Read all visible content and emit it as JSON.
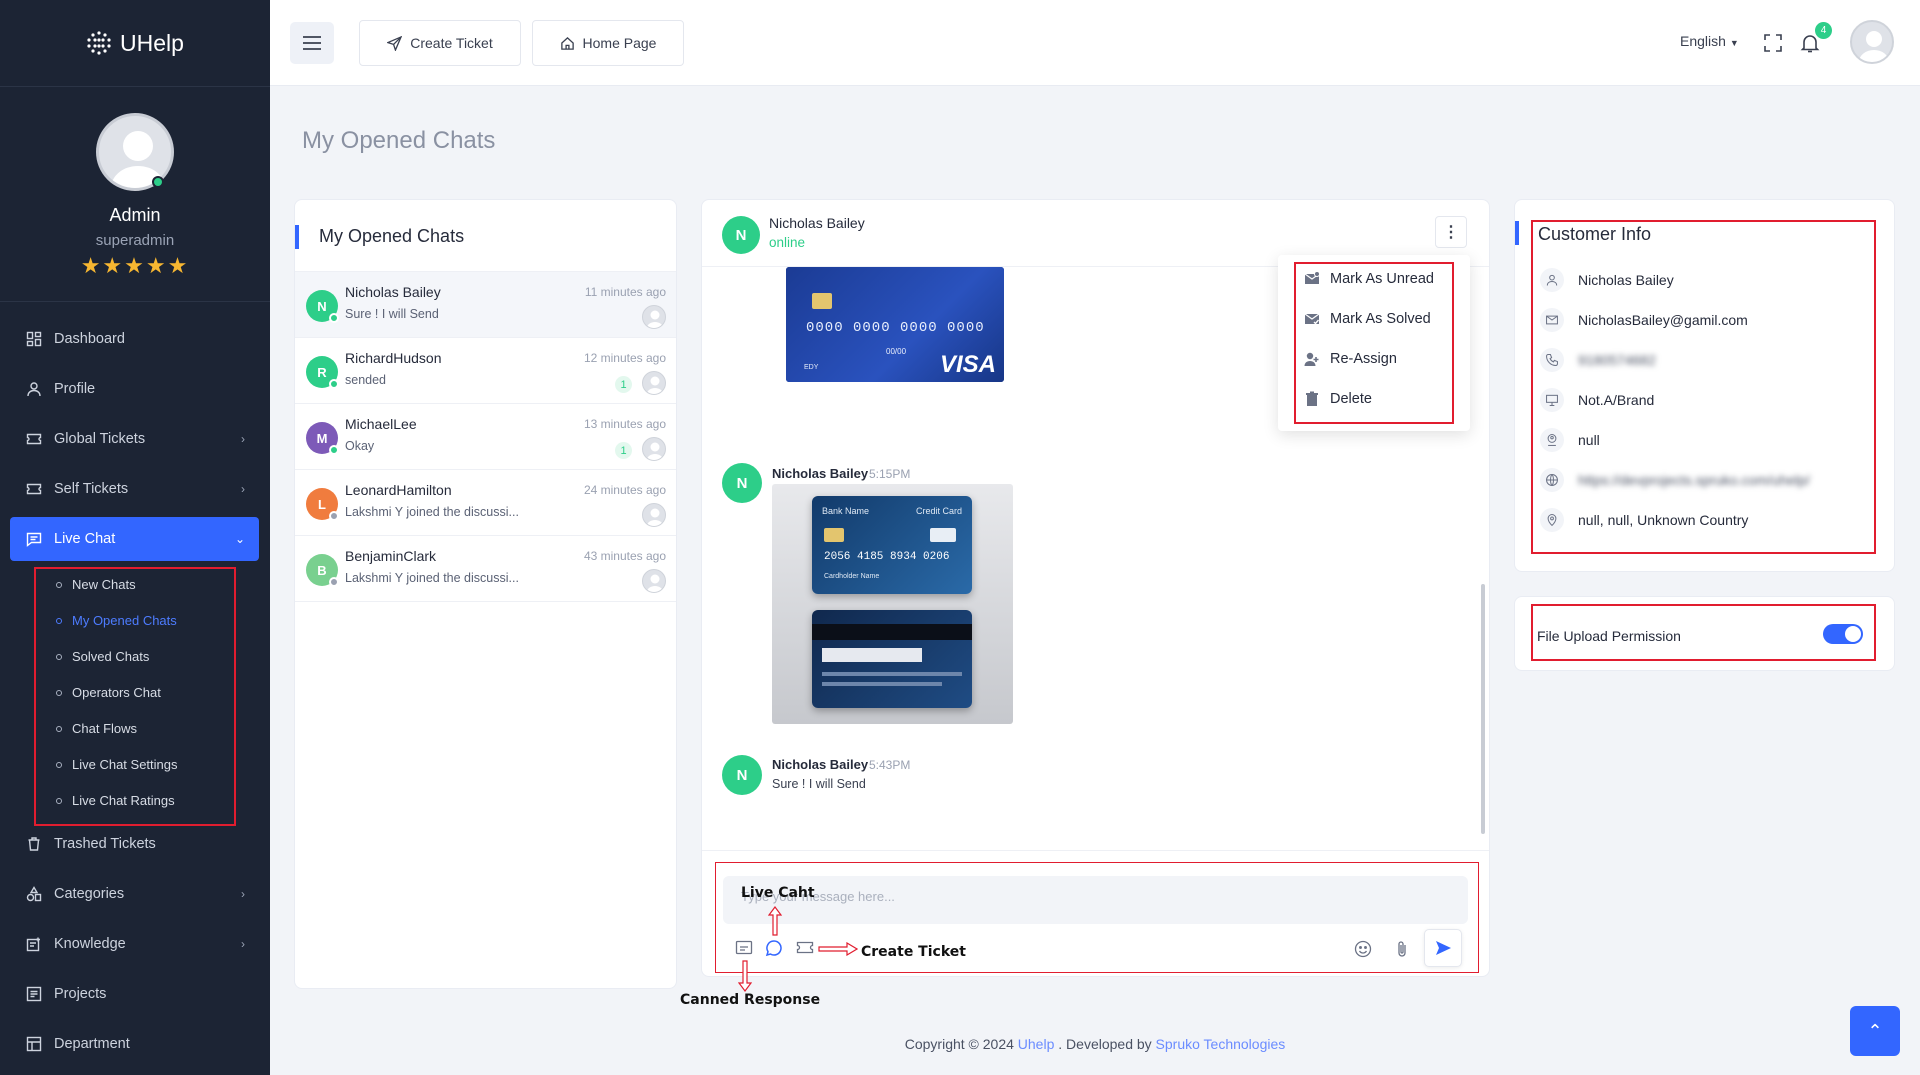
{
  "app": {
    "brand": "UHelp"
  },
  "user": {
    "name": "Admin",
    "role": "superadmin",
    "rating": "★★★★★"
  },
  "sidebar": {
    "items": [
      {
        "label": "Dashboard",
        "icon": "dashboard-icon"
      },
      {
        "label": "Profile",
        "icon": "user-icon"
      },
      {
        "label": "Global Tickets",
        "icon": "ticket-icon"
      },
      {
        "label": "Self Tickets",
        "icon": "ticket-icon"
      },
      {
        "label": "Live Chat",
        "icon": "chat-icon"
      },
      {
        "label": "Trashed Tickets",
        "icon": "trash-icon"
      },
      {
        "label": "Categories",
        "icon": "categories-icon"
      },
      {
        "label": "Knowledge",
        "icon": "knowledge-icon"
      },
      {
        "label": "Projects",
        "icon": "projects-icon"
      },
      {
        "label": "Department",
        "icon": "department-icon"
      }
    ],
    "live_chat_sub": [
      "New Chats",
      "My Opened Chats",
      "Solved Chats",
      "Operators Chat",
      "Chat Flows",
      "Live Chat Settings",
      "Live Chat Ratings"
    ]
  },
  "topbar": {
    "create_ticket": "Create Ticket",
    "home_page": "Home Page",
    "language": "English",
    "notifications": "4"
  },
  "page": {
    "title": "My Opened Chats"
  },
  "chat_list": {
    "title": "My Opened Chats",
    "chats": [
      {
        "initial": "N",
        "name": "Nicholas Bailey",
        "message": "Sure ! I will Send",
        "time": "11 minutes ago",
        "unread": "",
        "color": "#2dce89",
        "status": "#2dce89"
      },
      {
        "initial": "R",
        "name": "RichardHudson",
        "message": "sended",
        "time": "12 minutes ago",
        "unread": "1",
        "color": "#2dce89",
        "status": "#2dce89"
      },
      {
        "initial": "M",
        "name": "MichaelLee",
        "message": "Okay",
        "time": "13 minutes ago",
        "unread": "1",
        "color": "#7d5ab8",
        "status": "#2dce89"
      },
      {
        "initial": "L",
        "name": "LeonardHamilton",
        "message": "Lakshmi Y joined the discussi...",
        "time": "24 minutes ago",
        "unread": "",
        "color": "#f07c3e",
        "status": "#9aa1b1"
      },
      {
        "initial": "B",
        "name": "BenjaminClark",
        "message": "Lakshmi Y joined the discussi...",
        "time": "43 minutes ago",
        "unread": "",
        "color": "#79d08f",
        "status": "#9aa1b1"
      }
    ]
  },
  "conversation": {
    "contact": {
      "initial": "N",
      "name": "Nicholas Bailey",
      "status": "online"
    },
    "card1": {
      "number": "0000 0000 0000 0000",
      "expiry": "00/00",
      "brand": "VISA",
      "holder": "EDY"
    },
    "msg2": {
      "initial": "N",
      "name": "Nicholas Bailey",
      "time": "5:15PM"
    },
    "card2": {
      "bank": "Bank Name",
      "type": "Credit Card",
      "number": "2056 4185 8934 0206",
      "holder": "Cardholder Name"
    },
    "msg3": {
      "initial": "N",
      "name": "Nicholas Bailey",
      "time": "5:43PM",
      "text": "Sure ! I will Send"
    },
    "composer_placeholder": "Type your message here..."
  },
  "menu": {
    "items": [
      "Mark As Unread",
      "Mark As Solved",
      "Re-Assign",
      "Delete"
    ]
  },
  "customer_info": {
    "title": "Customer Info",
    "rows": [
      {
        "icon": "user-icon",
        "value": "Nicholas Bailey",
        "blurred": false
      },
      {
        "icon": "mail-icon",
        "value": "NicholasBailey@gamil.com",
        "blurred": false
      },
      {
        "icon": "phone-icon",
        "value": "9180574682",
        "blurred": true
      },
      {
        "icon": "monitor-icon",
        "value": "Not.A/Brand",
        "blurred": false
      },
      {
        "icon": "location-user-icon",
        "value": "null",
        "blurred": false
      },
      {
        "icon": "globe-icon",
        "value": "https://devprojects.spruko.com/uhelp/",
        "blurred": true
      },
      {
        "icon": "map-pin-icon",
        "value": "null, null, Unknown Country",
        "blurred": false
      }
    ]
  },
  "file_upload": {
    "label": "File Upload Permission",
    "enabled": true
  },
  "annotations": {
    "live_chat": "Live Caht",
    "create_ticket": "Create Ticket",
    "canned_response": "Canned Response"
  },
  "footer": {
    "copyright": "Copyright © 2024 ",
    "app_link": "Uhelp",
    "developed": " . Developed by ",
    "company": "Spruko Technologies"
  },
  "colors": {
    "primary": "#3366ff",
    "sidebar": "#1c2434",
    "success": "#2dce89",
    "annotation": "#e11d2f"
  }
}
